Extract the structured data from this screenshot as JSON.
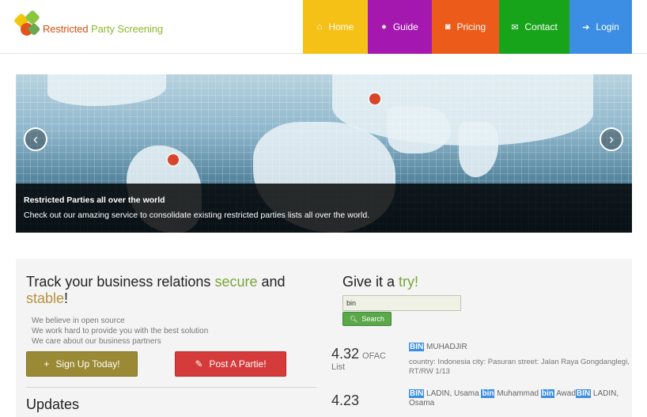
{
  "header": {
    "logo_part1": "Restricted",
    "logo_part2": "Party Screening",
    "nav": [
      {
        "label": "Home",
        "icon": "home-icon",
        "color": "#f5c116"
      },
      {
        "label": "Guide",
        "icon": "user-icon",
        "color": "#a418b0"
      },
      {
        "label": "Pricing",
        "icon": "money-icon",
        "color": "#ec5b1a"
      },
      {
        "label": "Contact",
        "icon": "envelope-icon",
        "color": "#17a41a"
      },
      {
        "label": "Login",
        "icon": "sign-in-icon",
        "color": "#3c8ee4"
      }
    ]
  },
  "carousel": {
    "prev": "‹",
    "next": "›",
    "caption_title": "Restricted Parties all over the world",
    "caption_text": "Check out our amazing service to consolidate existing restricted parties lists all over the world."
  },
  "intro": {
    "heading_a": "Track your business relations ",
    "heading_b": "secure",
    "heading_c": " and",
    "heading_d": "stable",
    "heading_e": "!",
    "beliefs": [
      "We believe in open source",
      "We work hard to provide you with the best solution",
      "We care about our business partners"
    ],
    "signup_label": "Sign Up Today!",
    "post_label": "Post A Partie!",
    "updates_heading": "Updates"
  },
  "try": {
    "heading_a": "Give it a ",
    "heading_b": "try!",
    "search_value": "bin",
    "search_button": "Search"
  },
  "results": [
    {
      "score": "4.32",
      "source": "OFAC",
      "list": "List",
      "hl": "BIN",
      "name": " MUHADJIR",
      "detail": "country: Indonesia city: Pasuran street: Jalan Raya Gongdanglegi, RT/RW 1/13"
    },
    {
      "score": "4.23",
      "hl1": "BIN",
      "t1": " LADIN, Usama ",
      "hl2": "bin",
      "t2": " Muhammad ",
      "hl3": "bin",
      "t3": " Awad",
      "hl4": "BIN",
      "t4": " LADIN, Osama"
    }
  ],
  "colors": {
    "accent_green": "#7aa53a",
    "accent_olive": "#b8923a",
    "highlight_blue": "#3c8ee4"
  }
}
